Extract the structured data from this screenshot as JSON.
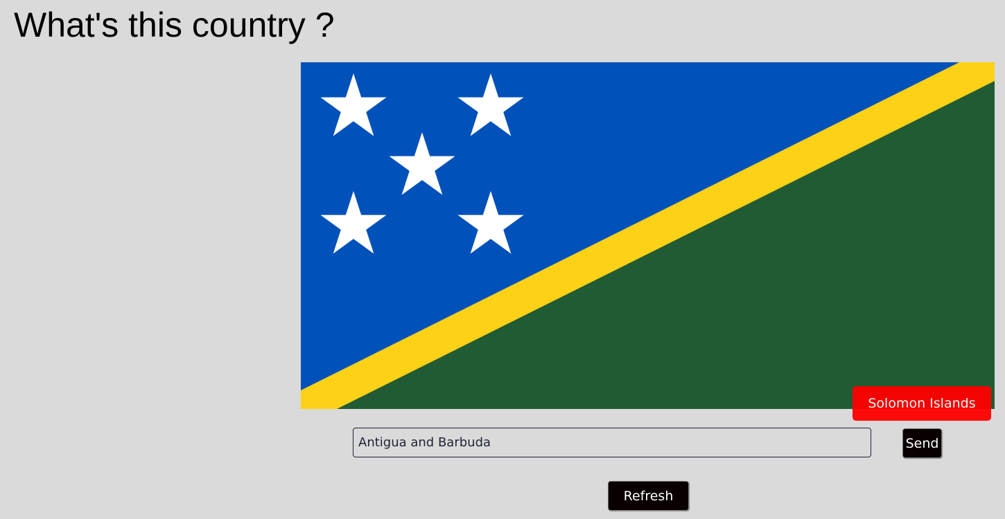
{
  "header": {
    "title": "What's this country ?"
  },
  "flag": {
    "icon": "solomon-islands-flag",
    "colors": {
      "blue": "#0051ba",
      "yellow": "#fcd116",
      "green": "#215b33",
      "stars": "#ffffff"
    }
  },
  "answer": {
    "label": "Solomon Islands",
    "color": "#ff0000"
  },
  "guess": {
    "value": "Antigua and Barbuda",
    "send_label": "Send"
  },
  "actions": {
    "refresh_label": "Refresh"
  }
}
